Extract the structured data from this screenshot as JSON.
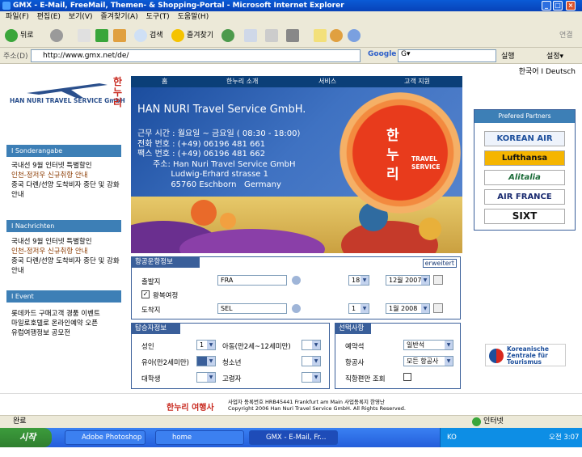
{
  "window": {
    "title": "GMX - E-Mail, FreeMail, Themen- & Shopping-Portal - Microsoft Internet Explorer"
  },
  "menu": [
    "파일(F)",
    "편집(E)",
    "보기(V)",
    "즐겨찾기(A)",
    "도구(T)",
    "도움말(H)"
  ],
  "toolbar": {
    "back": "뒤로",
    "search": "검색",
    "favorites": "즐겨찾기",
    "right": "연결"
  },
  "address": {
    "label": "주소(D)",
    "url": "http://www.gmx.net/de/",
    "google": "Google",
    "go_label": "G▾",
    "run": "실행",
    "settings": "설정▾"
  },
  "page": {
    "lang": "한국어 I Deutsch",
    "logo_text": "HAN NURI TRAVEL SERVICE GmbH",
    "logo_kr": "한누리",
    "nav": [
      "홈",
      "한누리 소개",
      "서비스",
      "고객 지원"
    ],
    "sections": [
      {
        "head": "I Sonderangabe",
        "items": [
          "국내선 9월 인터넷 특별할인",
          "인천-정저우 신규취항 안내",
          "중국 다롄/선양 도착비자 중단 및 강화안내"
        ]
      },
      {
        "head": "I Nachrichten",
        "items": [
          "국내선 9월 인터넷 특별할인",
          "인천-정저우 신규취항 안내",
          "중국 다롄/선양 도착비자 중단 및 강화안내"
        ]
      },
      {
        "head": "I Event",
        "items": [
          "롯데카드 구매고객 경품 이벤트",
          "마일로호텔로 온라인예약 오픈",
          "유럽여행정보 공모전"
        ]
      }
    ],
    "hero": {
      "title": "HAN NURI Travel Service GmbH.",
      "info": "근무 시간 : 월요일 ~ 금요일 ( 08:30 - 18:00)\n전화 번호 : (+49) 06196 481 661\n팩스 번호 : (+49) 06196 481 662\n      주소: Han Nuri Travel Service GmbH\n             Ludwig-Erhard strasse 1\n             65760 Eschborn   Germany",
      "sun_kr": "한\n누\n리",
      "sun_en": "TRAVEL\nSERVICE"
    },
    "booking": {
      "head": "항공운항정보",
      "more": "erweitert",
      "dep_label": "출발지",
      "dep_value": "FRA",
      "dep_day": "18",
      "dep_month": "12월 2007",
      "roundtrip": "왕복여정",
      "arr_label": "도착지",
      "arr_value": "SEL",
      "arr_day": "1",
      "arr_month": "1월 2008"
    },
    "passengers": {
      "head": "탑승자정보",
      "adult": "성인",
      "adult_v": "1",
      "child": "아동(만2세~12세미만)",
      "infant": "유아(만2세미만)",
      "youth": "청소년",
      "student": "대학생",
      "senior": "고령자"
    },
    "options": {
      "head": "선택사항",
      "class_label": "예약석",
      "class_value": "일반석",
      "airline_label": "항공사",
      "airline_value": "모든 항공사",
      "direct_label": "직항편만 조회"
    },
    "partners": {
      "head": "Prefered Partners",
      "logos": [
        "KOREAN AIR",
        "Lufthansa",
        "Alitalia",
        "AIR FRANCE",
        "SIXT"
      ]
    },
    "kzt": "Koreanische Zentrale für Tourismus",
    "footer_kr": "한누리 여행사",
    "footer_line1": "사업자 등록번호 HRB45441 Frankfurt am Main 사업등록지 한영난",
    "footer_line2": "Copyright 2006 Han Nuri Travel Service GmbH. All Rights Reserved."
  },
  "status": {
    "left": "완료",
    "right": "인터넷"
  },
  "taskbar": {
    "start": "시작",
    "tasks": [
      "Adobe Photoshop ...",
      "home",
      "GMX - E-Mail, Fr..."
    ],
    "ime": "KO",
    "time": "오전 3:07"
  }
}
